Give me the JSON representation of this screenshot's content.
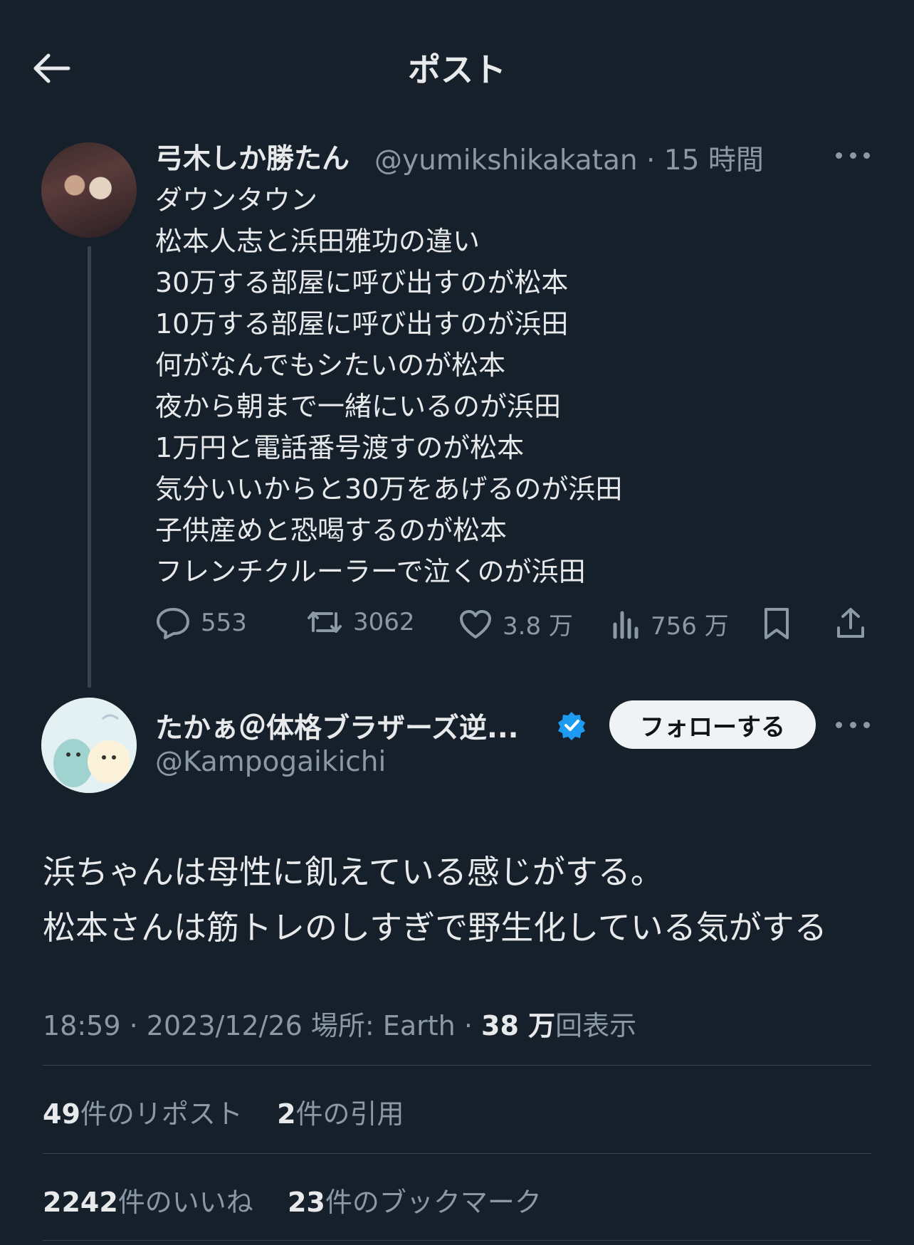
{
  "header": {
    "title": "ポスト"
  },
  "parent_post": {
    "display_name": "弓木しか勝たん",
    "handle": "@yumikshikakatan",
    "time": "· 15 時間",
    "lines": [
      "ダウンタウン",
      "松本人志と浜田雅功の違い",
      "30万する部屋に呼び出すのが松本",
      "10万する部屋に呼び出すのが浜田",
      "何がなんでもシたいのが松本",
      "夜から朝まで一緒にいるのが浜田",
      "1万円と電話番号渡すのが松本",
      "気分いいからと30万をあげるのが浜田",
      "子供産めと恐喝するのが松本",
      "フレンチクルーラーで泣くのが浜田"
    ],
    "actions": {
      "replies": "553",
      "reposts": "3062",
      "likes": "3.8 万",
      "views": "756 万"
    }
  },
  "reply_post": {
    "display_name": "たかぁ＠体格ブラザーズ逆...",
    "handle": "@Kampogaikichi",
    "follow_label": "フォローする",
    "lines": [
      "浜ちゃんは母性に飢えている感じがする。",
      "松本さんは筋トレのしすぎで野生化している気がする"
    ],
    "meta": {
      "time": "18:59",
      "date": "2023/12/26",
      "location": "場所: Earth",
      "views_num": "38 万",
      "views_label": "回表示"
    },
    "stats": {
      "reposts_num": "49",
      "reposts_label": "件のリポスト",
      "quotes_num": "2",
      "quotes_label": "件の引用",
      "likes_num": "2242",
      "likes_label": "件のいいね",
      "bookmarks_num": "23",
      "bookmarks_label": "件のブックマーク"
    }
  },
  "colors": {
    "background": "#15202b",
    "text": "#e7e9ea",
    "secondary": "#8b98a5",
    "verified": "#1d9bf0"
  }
}
